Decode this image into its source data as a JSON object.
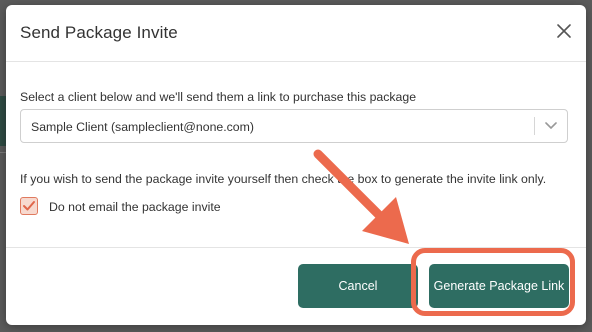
{
  "dialog": {
    "title": "Send Package Invite",
    "close_icon": "close-icon"
  },
  "content": {
    "select_instruction": "Select a client below and we'll send them a link to purchase this package",
    "client_select": {
      "value": "Sample Client (sampleclient@none.com)",
      "icon": "chevron-down-icon"
    },
    "self_send_instruction": "If you wish to send the package invite yourself then check the box to generate the invite link only.",
    "checkbox": {
      "label": "Do not email the package invite",
      "checked": true
    }
  },
  "footer": {
    "cancel_label": "Cancel",
    "generate_label": "Generate Package Link"
  },
  "colors": {
    "primary_button": "#2e6d62",
    "annotation": "#ec6a4d",
    "checkbox_border": "#e07a5f"
  }
}
